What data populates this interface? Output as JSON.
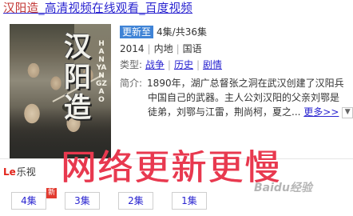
{
  "title": {
    "highlight": "汉阳造",
    "rest": "_高清视频在线观看_百度视频"
  },
  "poster": {
    "title_vertical": "汉阳造",
    "title_latin": "HANYANGZAO"
  },
  "status": {
    "badge": "更新至",
    "episodes": "4集/共36集"
  },
  "info": {
    "year": "2014",
    "region": "内地",
    "language": "国语"
  },
  "genres": {
    "label": "类型:",
    "items": [
      "战争",
      "历史",
      "剧情"
    ]
  },
  "synopsis": {
    "label": "简介:",
    "lines": [
      "1890年，湖广总督张之洞在武汉创建了汉阳兵",
      "中国自己的武器。主人公刘汉阳的父亲刘鄂是",
      "徒弟，刘鄂与江雷，荆尚柯，夏之..."
    ],
    "more": "更多>>",
    "toggle_icon": "chevron-down-icon"
  },
  "source": {
    "logo": "Le",
    "name": "乐视",
    "caret": "▾"
  },
  "annotation": "网络更新更慢",
  "watermark": "Baidu经验",
  "episodes": [
    "4集",
    "3集",
    "2集",
    "1集"
  ],
  "new_badge": "新",
  "colors": {
    "link": "#2a24d0",
    "highlight": "#c0312f",
    "badge": "#3f83d6",
    "handwriting": "#e8394f",
    "new_badge": "#e23a2f"
  }
}
